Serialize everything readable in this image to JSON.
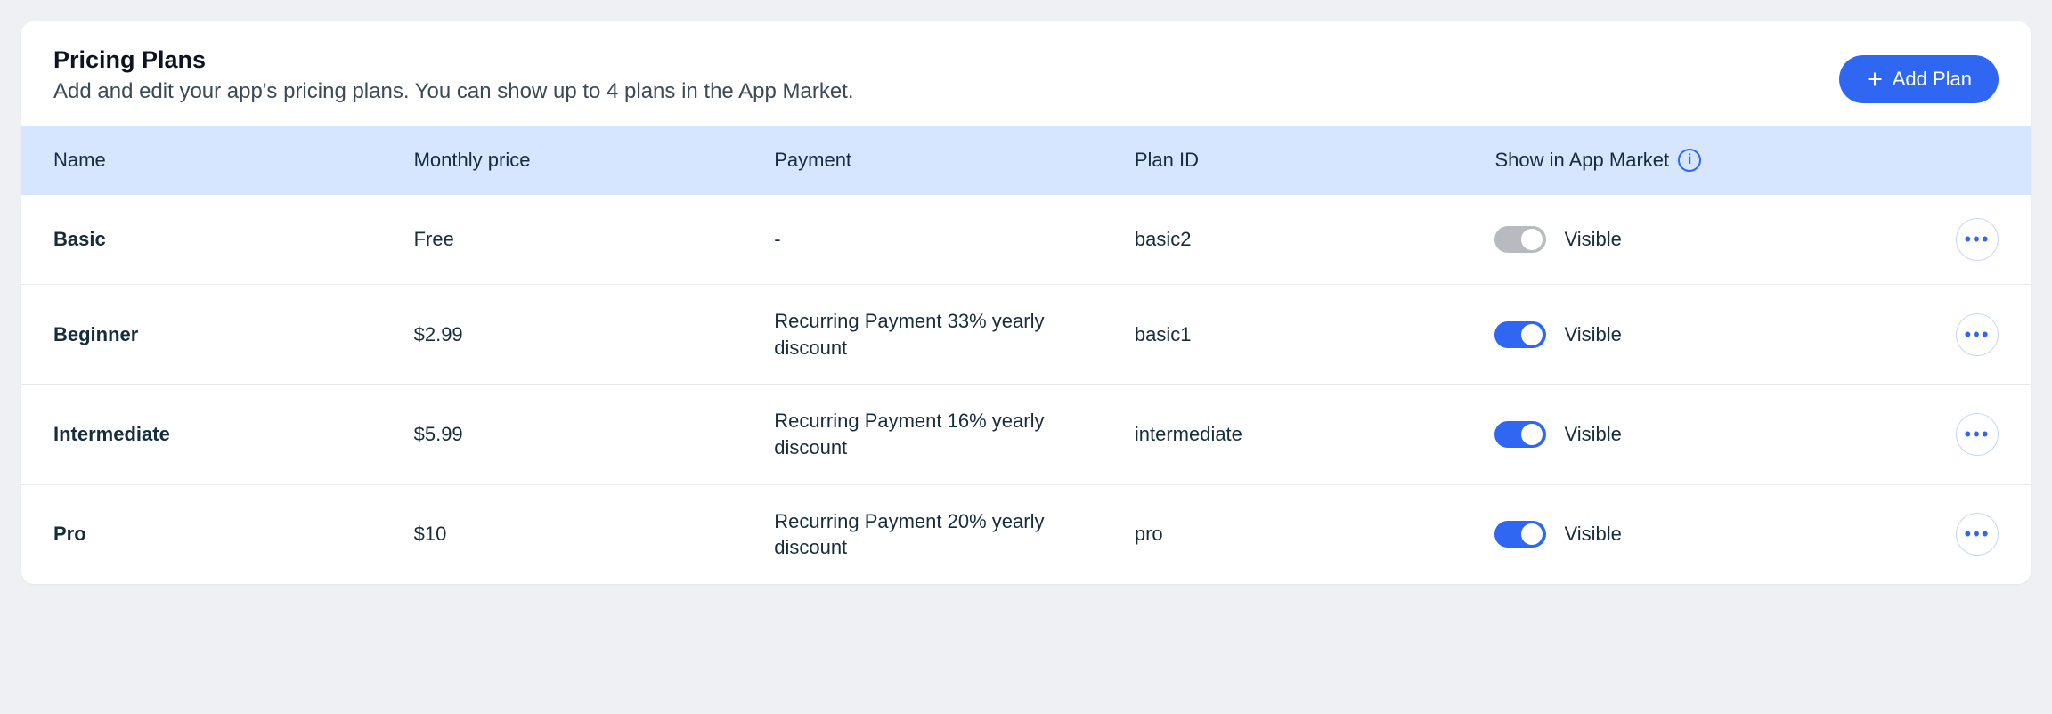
{
  "header": {
    "title": "Pricing Plans",
    "subtitle": "Add and edit your app's pricing plans. You can show up to 4 plans in the App Market.",
    "add_button": "Add Plan"
  },
  "columns": {
    "name": "Name",
    "monthly_price": "Monthly price",
    "payment": "Payment",
    "plan_id": "Plan ID",
    "show_in_market": "Show in App Market"
  },
  "rows": [
    {
      "name": "Basic",
      "monthly_price": "Free",
      "payment": "-",
      "plan_id": "basic2",
      "visible_label": "Visible",
      "toggle_on": false
    },
    {
      "name": "Beginner",
      "monthly_price": "$2.99",
      "payment": "Recurring Payment 33% yearly discount",
      "plan_id": "basic1",
      "visible_label": "Visible",
      "toggle_on": true
    },
    {
      "name": "Intermediate",
      "monthly_price": "$5.99",
      "payment": "Recurring Payment 16% yearly discount",
      "plan_id": "intermediate",
      "visible_label": "Visible",
      "toggle_on": true
    },
    {
      "name": "Pro",
      "monthly_price": "$10",
      "payment": "Recurring Payment 20% yearly discount",
      "plan_id": "pro",
      "visible_label": "Visible",
      "toggle_on": true
    }
  ]
}
